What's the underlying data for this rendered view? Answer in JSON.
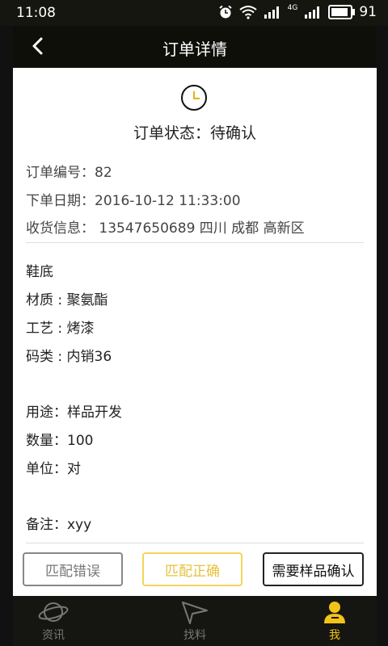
{
  "status_bar": {
    "time": "11:08",
    "battery": "91",
    "signal_label": "4G"
  },
  "header": {
    "title": "订单详情"
  },
  "order": {
    "status_line": "订单状态：待确认",
    "order_no": "订单编号：82",
    "order_date": "下单日期：2016-10-12 11:33:00",
    "shipping_info": "收货信息： 13547650689 四川 成都 高新区",
    "item_name": "鞋底",
    "material": "材质 : 聚氨酯",
    "process": "工艺 : 烤漆",
    "size_type": "码类 : 内销36",
    "usage": "用途：样品开发",
    "quantity": "数量：100",
    "unit": "单位：对",
    "remark": "备注：xyy"
  },
  "actions": {
    "wrong_match": "匹配错误",
    "correct_match": "匹配正确",
    "need_sample": "需要样品确认"
  },
  "tabs": [
    {
      "label": "资讯",
      "icon": "planet-icon",
      "active": false
    },
    {
      "label": "找料",
      "icon": "paper-plane-icon",
      "active": false
    },
    {
      "label": "我",
      "icon": "user-icon",
      "active": true
    }
  ],
  "colors": {
    "accent": "#f2c318",
    "dark": "#0f0f0a"
  }
}
